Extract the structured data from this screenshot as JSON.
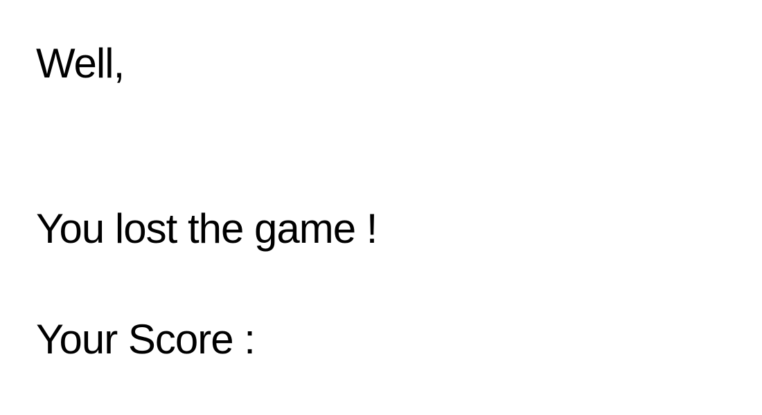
{
  "game_over_screen": {
    "greeting": "Well,",
    "result_message": "You lost the game !",
    "score_label": "Your Score :"
  },
  "colors": {
    "background": "#ffffff",
    "text": "#000000"
  }
}
